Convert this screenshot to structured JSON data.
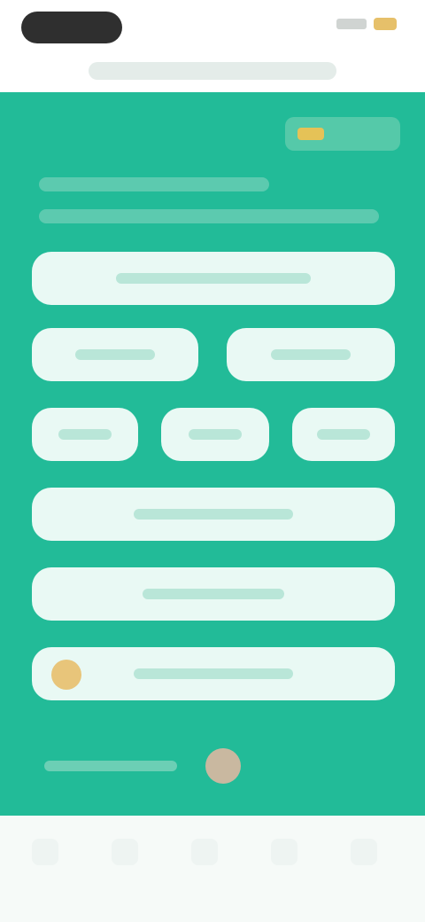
{
  "header": {
    "title": ""
  },
  "brand": {
    "label": ""
  },
  "intro": {
    "line1": "",
    "line2": ""
  },
  "options": [
    {
      "label": ""
    },
    {
      "label": ""
    },
    {
      "label": ""
    },
    {
      "label": ""
    },
    {
      "label": ""
    },
    {
      "label": ""
    },
    {
      "label": ""
    },
    {
      "label": ""
    },
    {
      "label": ""
    }
  ],
  "footer": {
    "text": ""
  },
  "colors": {
    "panel": "#22bb98",
    "option": "#e9f9f4",
    "accent": "#e5c257"
  }
}
